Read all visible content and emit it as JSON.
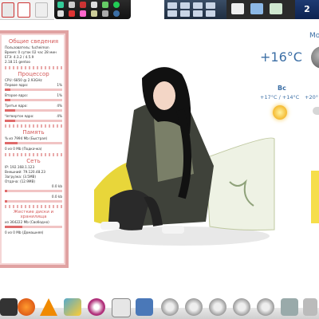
{
  "clock": {
    "time": "2"
  },
  "sysmon": {
    "title": "Общие сведения",
    "general": [
      "Пользователь: fucheimon",
      "Время: 0 суток 02 час 28 мин",
      "ЕГЭ: 4.3.2 / 4.5.9",
      "2.18.11 gentoo"
    ],
    "cpu_title": "Процессор",
    "cpu_name": "CPU: 6850 @ 2.93GHz",
    "cpu_items": [
      {
        "label": "Первое ядро:",
        "val": "1%"
      },
      {
        "label": "Второе ядро:",
        "val": "1%"
      },
      {
        "label": "Третье ядро:",
        "val": "4%"
      },
      {
        "label": "Четвертое ядро:",
        "val": "4%"
      }
    ],
    "mem_title": "Память",
    "mem_lines": [
      "% из 7994 Mb (Быстрая)",
      "0 из 0 Mb (Подкачка)"
    ],
    "net_title": "Сеть",
    "net_lines": [
      "IP: 192.168.1.123",
      "Внешний: 79.120.48.23",
      "Загрузка: (3.5MB)",
      "Отдача: (12.9MB)"
    ],
    "net_speed": [
      "0.0 kb",
      "0.0 kb"
    ],
    "disk_title": "Жесткие диски и хранилища",
    "disk_lines": [
      "из 364222 Mb (Свободно)",
      "0 из 0 Mb (Домашняя)"
    ]
  },
  "weather": {
    "title": "Мос",
    "current_temp": "+16°C",
    "day": "Вс",
    "range": "+17°C / +14°C",
    "range2": "+20°"
  },
  "colors": {
    "accent": "#3b6ea5",
    "sysmon_border": "#e0a2a2",
    "sysmon_header": "#d45a5a"
  },
  "dock_icons": [
    "terminal-icon",
    "firefox-icon",
    "vlc-icon",
    "paint-icon",
    "eye-icon",
    "editor-icon",
    "box-icon",
    "gear-icon",
    "gear-icon",
    "gear-icon",
    "gear-icon",
    "gear-icon",
    "gear-icon",
    "gear-icon",
    "gear-icon",
    "network-icon",
    "trash-icon"
  ]
}
